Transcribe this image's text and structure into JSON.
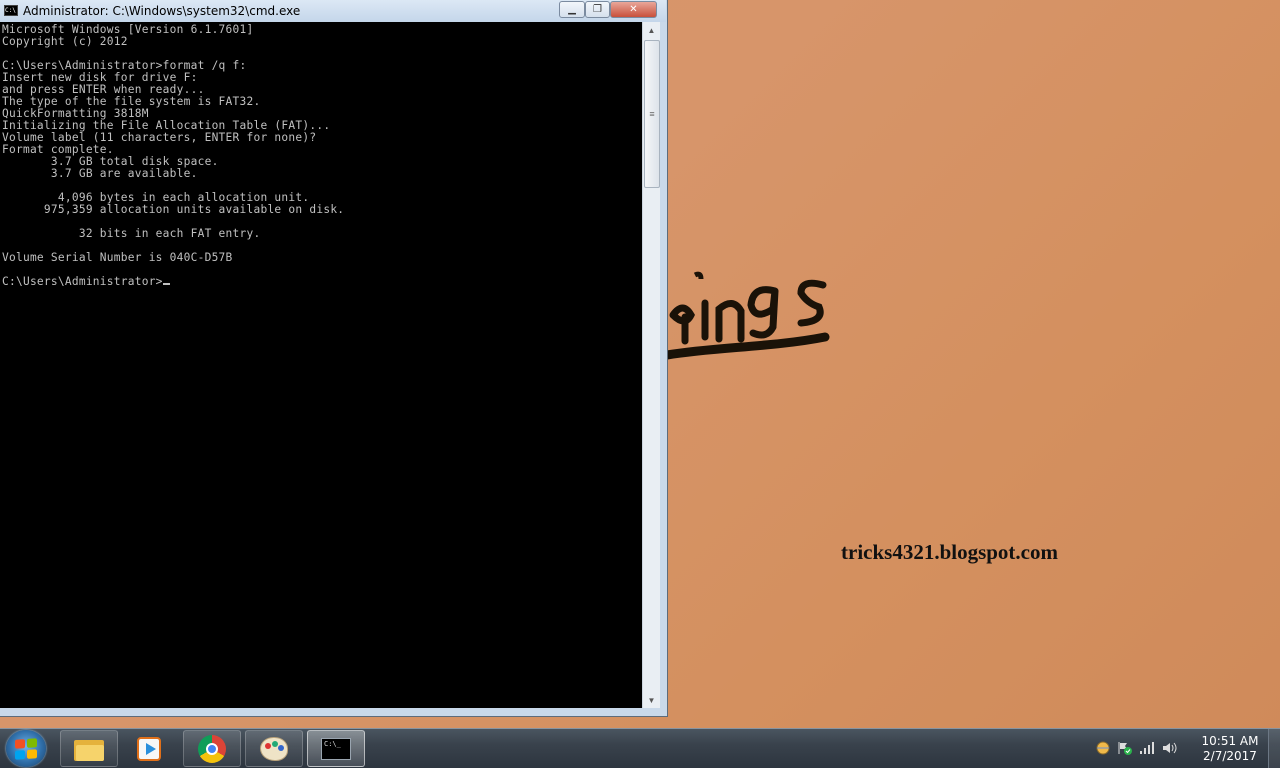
{
  "window": {
    "title": "Administrator: C:\\Windows\\system32\\cmd.exe",
    "icon": "cmd-icon",
    "min_icon": "minimize-icon",
    "max_icon": "maximize-icon",
    "close_icon": "close-icon"
  },
  "console": {
    "lines": [
      "Microsoft Windows [Version 6.1.7601]",
      "Copyright (c) 2012",
      "",
      "C:\\Users\\Administrator>format /q f:",
      "Insert new disk for drive F:",
      "and press ENTER when ready...",
      "The type of the file system is FAT32.",
      "QuickFormatting 3818M",
      "Initializing the File Allocation Table (FAT)...",
      "Volume label (11 characters, ENTER for none)?",
      "Format complete.",
      "       3.7 GB total disk space.",
      "       3.7 GB are available.",
      "",
      "        4,096 bytes in each allocation unit.",
      "      975,359 allocation units available on disk.",
      "",
      "           32 bits in each FAT entry.",
      "",
      "Volume Serial Number is 040C-D57B",
      ""
    ],
    "prompt": "C:\\Users\\Administrator>"
  },
  "desktop": {
    "watermark": "tricks4321.blogspot.com"
  },
  "taskbar": {
    "items": [
      {
        "name": "windows-explorer",
        "icon": "folder-icon"
      },
      {
        "name": "windows-media-player",
        "icon": "media-player-icon"
      },
      {
        "name": "google-chrome",
        "icon": "chrome-icon"
      },
      {
        "name": "paint",
        "icon": "paint-palette-icon"
      },
      {
        "name": "command-prompt",
        "icon": "cmd-icon",
        "active": true
      }
    ],
    "tray_icons": [
      "network-globe-icon",
      "action-center-flag-icon",
      "signal-bars-icon",
      "volume-icon"
    ],
    "clock": {
      "time": "10:51 AM",
      "date": "2/7/2017"
    }
  },
  "colors": {
    "console_bg": "#000000",
    "console_fg": "#c0c0c0",
    "desktop_bg": "#d9966a",
    "taskbar": "#3a434d"
  }
}
